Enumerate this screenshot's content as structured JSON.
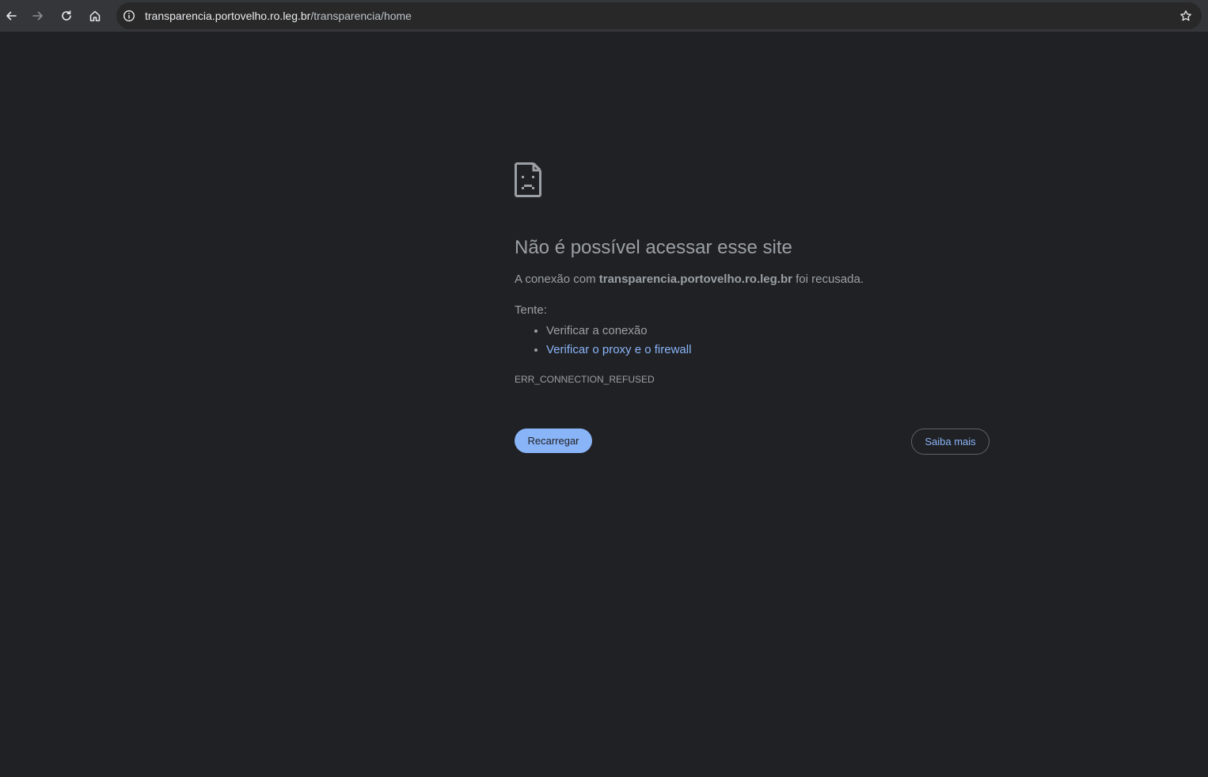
{
  "browser": {
    "url_host": "transparencia.portovelho.ro.leg.br",
    "url_path": "/transparencia/home",
    "icons": {
      "back": "arrow-left-icon",
      "forward": "arrow-right-icon",
      "reload": "reload-icon",
      "home": "home-icon",
      "site_info": "info-icon",
      "bookmark": "star-icon"
    }
  },
  "error_page": {
    "icon": "sad-page-icon",
    "title": "Não é possível acessar esse site",
    "description_prefix": "A conexão com ",
    "description_host": "transparencia.portovelho.ro.leg.br",
    "description_suffix": " foi recusada.",
    "try_label": "Tente:",
    "suggestions": [
      "Verificar a conexão",
      "Verificar o proxy e o firewall"
    ],
    "error_code": "ERR_CONNECTION_REFUSED",
    "reload_button": "Recarregar",
    "learn_more_button": "Saiba mais"
  },
  "colors": {
    "background": "#202124",
    "toolbar": "#35363a",
    "text": "#9aa0a6",
    "link": "#8ab4f8",
    "primary_button": "#8ab4f8"
  }
}
